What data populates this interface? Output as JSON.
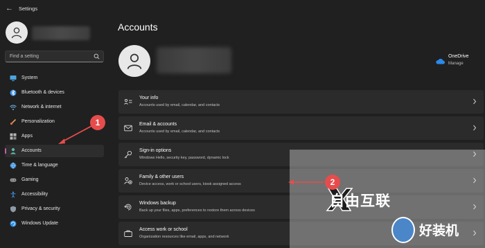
{
  "window": {
    "title": "Settings"
  },
  "search": {
    "placeholder": "Find a setting"
  },
  "sidebar": {
    "items": [
      {
        "label": "System",
        "icon": "monitor-icon",
        "active": false
      },
      {
        "label": "Bluetooth & devices",
        "icon": "bluetooth-icon",
        "active": false
      },
      {
        "label": "Network & internet",
        "icon": "wifi-icon",
        "active": false
      },
      {
        "label": "Personalization",
        "icon": "brush-icon",
        "active": false
      },
      {
        "label": "Apps",
        "icon": "apps-icon",
        "active": false
      },
      {
        "label": "Accounts",
        "icon": "person-icon",
        "active": true
      },
      {
        "label": "Time & language",
        "icon": "globe-icon",
        "active": false
      },
      {
        "label": "Gaming",
        "icon": "gamepad-icon",
        "active": false
      },
      {
        "label": "Accessibility",
        "icon": "accessibility-icon",
        "active": false
      },
      {
        "label": "Privacy & security",
        "icon": "shield-icon",
        "active": false
      },
      {
        "label": "Windows Update",
        "icon": "update-icon",
        "active": false
      }
    ]
  },
  "main": {
    "title": "Accounts",
    "onedrive": {
      "name": "OneDrive",
      "action": "Manage"
    },
    "cards": [
      {
        "title": "Your info",
        "subtitle": "Accounts used by email, calendar, and contacts",
        "icon": "id-card-icon"
      },
      {
        "title": "Email & accounts",
        "subtitle": "Accounts used by email, calendar, and contacts",
        "icon": "mail-icon"
      },
      {
        "title": "Sign-in options",
        "subtitle": "Windows Hello, security key, password, dynamic lock",
        "icon": "key-icon"
      },
      {
        "title": "Family & other users",
        "subtitle": "Device access, work or school users, kiosk assigned access",
        "icon": "family-icon"
      },
      {
        "title": "Windows backup",
        "subtitle": "Back up your files, apps, preferences to restore them across devices",
        "icon": "backup-icon"
      },
      {
        "title": "Access work or school",
        "subtitle": "Organization resources like email, apps, and network",
        "icon": "briefcase-icon"
      }
    ]
  },
  "annotations": {
    "badge1": "1",
    "badge2": "2"
  },
  "watermark": {
    "text1": "自由互联",
    "text2": "好装机"
  },
  "colors": {
    "accent": "#c75ea8",
    "annotation": "#e74c4c",
    "background": "#202020",
    "card": "#2b2b2b"
  }
}
